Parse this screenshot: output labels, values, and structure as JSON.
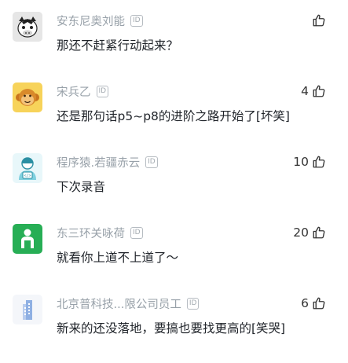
{
  "comments": [
    {
      "name": "安东尼奥刘能",
      "badge": "ID",
      "text": "那还不赶紧行动起来？",
      "likes": "",
      "avatar": "zebra-avatar"
    },
    {
      "name": "宋兵乙",
      "badge": "ID",
      "text": "还是那句话p5~p8的进阶之路开始了[坏笑]",
      "likes": "4",
      "avatar": "monkey-avatar"
    },
    {
      "name": "程序猿.若疆赤云",
      "badge": "ID",
      "text": "下次录音",
      "likes": "10",
      "avatar": "programmer-avatar"
    },
    {
      "name": "东三环关咏荷",
      "badge": "ID",
      "text": "就看你上道不上道了～",
      "likes": "20",
      "avatar": "person-avatar"
    },
    {
      "name": "北京普科技...限公司员工",
      "badge": "ID",
      "text": "新来的还没落地，要搞也要找更高的[笑哭]",
      "likes": "6",
      "avatar": "building-avatar"
    }
  ],
  "colors": {
    "name": "#98a1a9",
    "text": "#1f2329",
    "icon": "#333333"
  }
}
